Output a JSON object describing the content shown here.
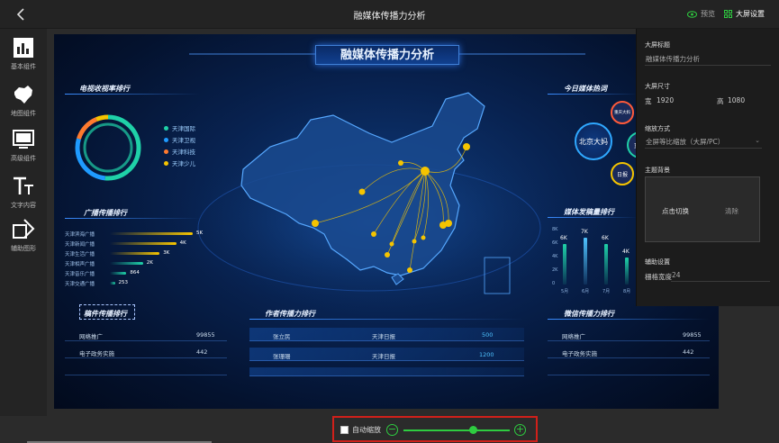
{
  "header": {
    "title": "融媒体传播力分析",
    "preview_label": "预览",
    "screen_settings_label": "大屏设置"
  },
  "sidebar": {
    "items": [
      {
        "label": "基本组件",
        "icon": "bar-chart-icon"
      },
      {
        "label": "地图组件",
        "icon": "map-icon"
      },
      {
        "label": "高级组件",
        "icon": "monitor-icon"
      },
      {
        "label": "文字内容",
        "icon": "text-icon"
      },
      {
        "label": "辅助图形",
        "icon": "shapes-icon"
      }
    ]
  },
  "settings_panel": {
    "screen_title_label": "大屏标题",
    "screen_title_value": "融媒体传播力分析",
    "screen_size_label": "大屏尺寸",
    "width_label": "宽",
    "width_value": "1920",
    "height_label": "高",
    "height_value": "1080",
    "scale_label": "缩放方式",
    "scale_value": "全屏等比缩放（大屏/PC）",
    "theme_bg_label": "主题背景",
    "switch_label": "点击切换",
    "clear_label": "清除",
    "aux_label": "辅助设置",
    "grid_label": "栅格宽度",
    "grid_value": "24"
  },
  "bottom": {
    "auto_zoom_label": "自动缩放",
    "auto_zoom_checked": false,
    "zoom_level": 0.65
  },
  "dashboard": {
    "title": "融媒体传播力分析",
    "tv_rating": {
      "title": "电视收视率排行",
      "legend": [
        {
          "name": "天津国际",
          "color": "#1fd1a8"
        },
        {
          "name": "天津卫视",
          "color": "#1f9bff"
        },
        {
          "name": "天津科技",
          "color": "#ff7a2e"
        },
        {
          "name": "天津少儿",
          "color": "#f5c400"
        }
      ]
    },
    "broadcast_rank": {
      "title": "广播传播排行",
      "rows": [
        {
          "label": "天津滨海广播",
          "value": "5K",
          "ratio": 1.0,
          "color": "#f5c400"
        },
        {
          "label": "天津新闻广播",
          "value": "4K",
          "ratio": 0.8,
          "color": "#f5c400"
        },
        {
          "label": "天津生活广播",
          "value": "3K",
          "ratio": 0.6,
          "color": "#f5c400"
        },
        {
          "label": "天津相声广播",
          "value": "2K",
          "ratio": 0.4,
          "color": "#1fd1a8"
        },
        {
          "label": "天津音乐广播",
          "value": "864",
          "ratio": 0.2,
          "color": "#1fd1a8"
        },
        {
          "label": "天津交通广播",
          "value": "253",
          "ratio": 0.06,
          "color": "#1fd1a8"
        }
      ]
    },
    "manuscript_rank": {
      "title": "稿件传播排行",
      "rows": [
        {
          "name": "网络推广",
          "value": "99855"
        },
        {
          "name": "电子政务实施",
          "value": "442"
        }
      ]
    },
    "author_rank": {
      "title": "作者传播力排行",
      "rows": [
        {
          "name": "张立民",
          "source": "天津日报",
          "value": "500"
        },
        {
          "name": "张珊珊",
          "source": "天津日报",
          "value": "1200"
        }
      ]
    },
    "wechat_rank": {
      "title": "微信传播力排行",
      "rows": [
        {
          "name": "网络推广",
          "value": "99855"
        },
        {
          "name": "电子政务实施",
          "value": "442"
        }
      ]
    },
    "hot_topics": {
      "title": "今日媒体热词",
      "words": [
        "北京大妈",
        "重庆大妈",
        "日报",
        "重"
      ]
    },
    "media_output": {
      "title": "媒体发稿量排行",
      "y_ticks": [
        "8K",
        "6K",
        "4K",
        "2K",
        "0"
      ],
      "categories": [
        "5月",
        "6月",
        "7月",
        "8月"
      ],
      "values": [
        6,
        7,
        6,
        4
      ],
      "labels": [
        "6K",
        "7K",
        "6K",
        "4K"
      ]
    }
  }
}
